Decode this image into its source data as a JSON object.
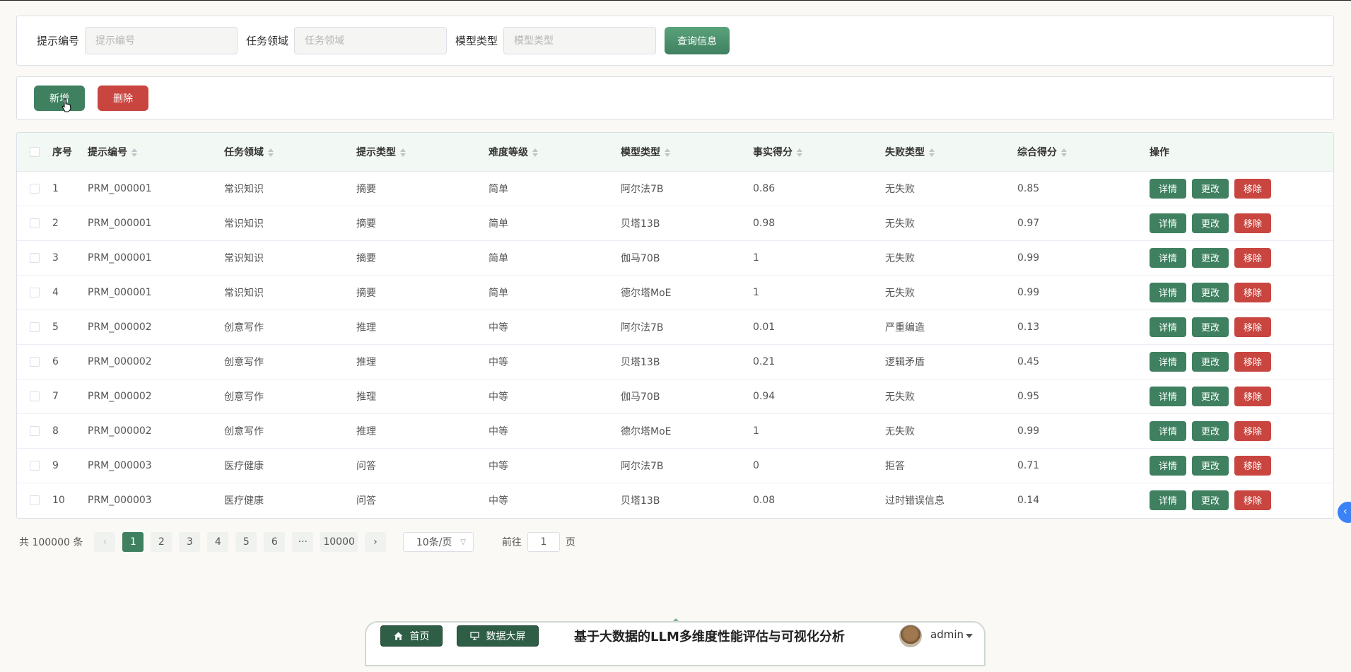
{
  "search": {
    "fields": [
      {
        "label": "提示编号",
        "placeholder": "提示编号"
      },
      {
        "label": "任务领域",
        "placeholder": "任务领域"
      },
      {
        "label": "模型类型",
        "placeholder": "模型类型"
      }
    ],
    "query_label": "查询信息"
  },
  "actions": {
    "add_label": "新增",
    "delete_label": "删除"
  },
  "table": {
    "headers": [
      "序号",
      "提示编号",
      "任务领域",
      "提示类型",
      "难度等级",
      "模型类型",
      "事实得分",
      "失败类型",
      "综合得分",
      "操作"
    ],
    "row_actions": {
      "detail": "详情",
      "edit": "更改",
      "remove": "移除"
    },
    "rows": [
      [
        "1",
        "PRM_000001",
        "常识知识",
        "摘要",
        "简单",
        "阿尔法7B",
        "0.86",
        "无失败",
        "0.85"
      ],
      [
        "2",
        "PRM_000001",
        "常识知识",
        "摘要",
        "简单",
        "贝塔13B",
        "0.98",
        "无失败",
        "0.97"
      ],
      [
        "3",
        "PRM_000001",
        "常识知识",
        "摘要",
        "简单",
        "伽马70B",
        "1",
        "无失败",
        "0.99"
      ],
      [
        "4",
        "PRM_000001",
        "常识知识",
        "摘要",
        "简单",
        "德尔塔MoE",
        "1",
        "无失败",
        "0.99"
      ],
      [
        "5",
        "PRM_000002",
        "创意写作",
        "推理",
        "中等",
        "阿尔法7B",
        "0.01",
        "严重编造",
        "0.13"
      ],
      [
        "6",
        "PRM_000002",
        "创意写作",
        "推理",
        "中等",
        "贝塔13B",
        "0.21",
        "逻辑矛盾",
        "0.45"
      ],
      [
        "7",
        "PRM_000002",
        "创意写作",
        "推理",
        "中等",
        "伽马70B",
        "0.94",
        "无失败",
        "0.95"
      ],
      [
        "8",
        "PRM_000002",
        "创意写作",
        "推理",
        "中等",
        "德尔塔MoE",
        "1",
        "无失败",
        "0.99"
      ],
      [
        "9",
        "PRM_000003",
        "医疗健康",
        "问答",
        "中等",
        "阿尔法7B",
        "0",
        "拒答",
        "0.71"
      ],
      [
        "10",
        "PRM_000003",
        "医疗健康",
        "问答",
        "中等",
        "贝塔13B",
        "0.08",
        "过时错误信息",
        "0.14"
      ]
    ]
  },
  "pagination": {
    "total_text": "共 100000 条",
    "prev": "‹",
    "next": "›",
    "pages": [
      "1",
      "2",
      "3",
      "4",
      "5",
      "6",
      "···",
      "10000"
    ],
    "current": "1",
    "page_size": "10条/页",
    "goto_prefix": "前往",
    "goto_value": "1",
    "goto_suffix": "页"
  },
  "bottom_bar": {
    "home_label": "首页",
    "screen_label": "数据大屏",
    "title": "基于大数据的LLM多维度性能评估与可视化分析",
    "user": "admin"
  },
  "colors": {
    "primary": "#3f8060",
    "danger": "#c9453f",
    "header_bg": "#f2f8f3"
  }
}
